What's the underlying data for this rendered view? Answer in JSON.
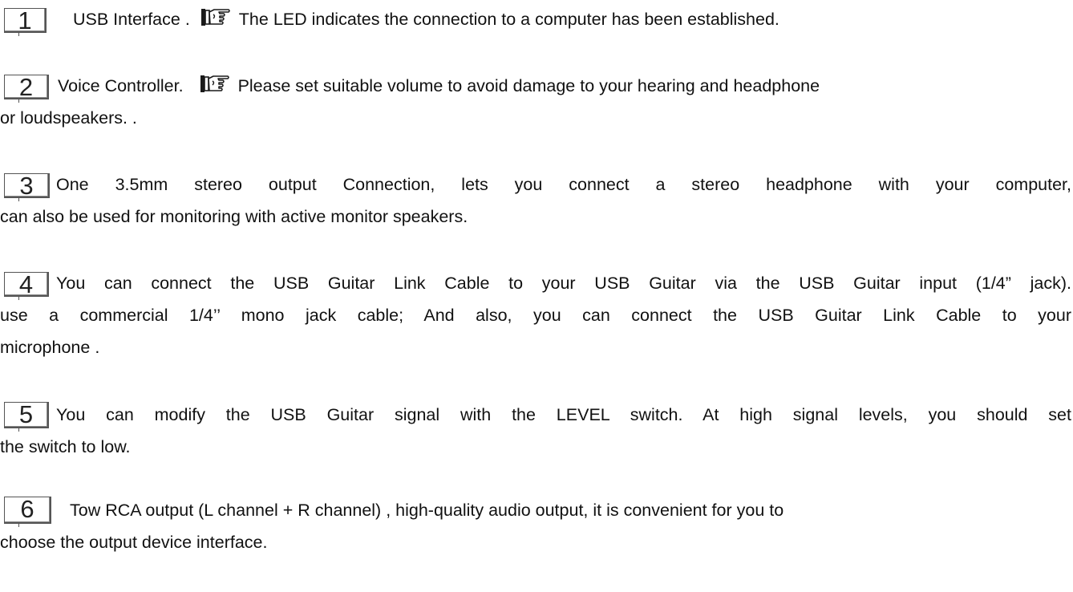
{
  "items": [
    {
      "number": "1",
      "lead": "USB Interface .",
      "note": "The LED indicates the connection to a computer has been established.",
      "note_icon": "pointing-hand-icon"
    },
    {
      "number": "2",
      "lead": "Voice Controller.",
      "note": "Please set suitable volume to avoid damage to your hearing and headphone",
      "note_icon": "pointing-hand-icon",
      "line2": "or loudspeakers. ."
    },
    {
      "number": "3",
      "line1": "One 3.5mm stereo output Connection, lets you connect a stereo headphone with your computer,",
      "line2": "can also be used for monitoring with active monitor speakers."
    },
    {
      "number": "4",
      "line1": "You can connect the USB Guitar Link Cable to your USB Guitar via the USB Guitar input (1/4” jack).",
      "line2": "use a commercial 1/4’’ mono jack cable; And also, you can connect the USB Guitar Link Cable to your",
      "line3": "microphone ."
    },
    {
      "number": "5",
      "line1": "You can modify the USB Guitar signal with the LEVEL switch. At high signal levels, you should set",
      "line2": "the switch to low."
    },
    {
      "number": "6",
      "line1": "Tow RCA output (L channel + R channel) , high-quality audio output, it is convenient for you to",
      "line2": "choose the output device interface."
    }
  ]
}
